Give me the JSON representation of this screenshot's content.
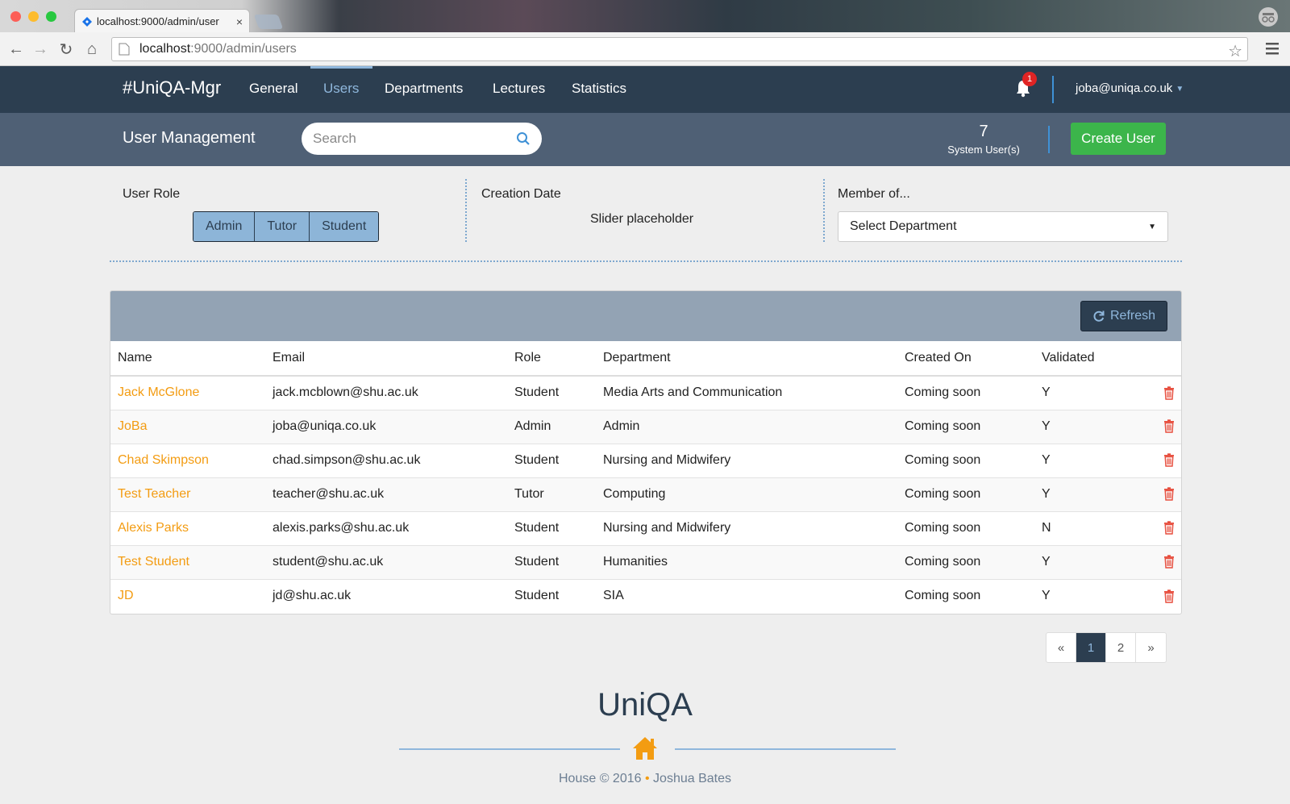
{
  "browser": {
    "tab_title": "localhost:9000/admin/user",
    "tab_close": "×",
    "url_host": "localhost",
    "url_rest": ":9000/admin/users"
  },
  "nav": {
    "brand": "#UniQA-Mgr",
    "items": [
      {
        "label": "General"
      },
      {
        "label": "Users"
      },
      {
        "label": "Departments"
      },
      {
        "label": "Lectures"
      },
      {
        "label": "Statistics"
      }
    ],
    "notification_count": "1",
    "user_email": "joba@uniqa.co.uk"
  },
  "subheader": {
    "title": "User Management",
    "search_placeholder": "Search",
    "user_count": "7",
    "user_count_label": "System User(s)",
    "create_button": "Create User"
  },
  "filters": {
    "role_label": "User Role",
    "roles": [
      "Admin",
      "Tutor",
      "Student"
    ],
    "date_label": "Creation Date",
    "slider_placeholder": "Slider placeholder",
    "member_label": "Member of...",
    "department_select": "Select Department"
  },
  "table": {
    "refresh_label": "Refresh",
    "columns": [
      "Name",
      "Email",
      "Role",
      "Department",
      "Created On",
      "Validated"
    ],
    "rows": [
      {
        "name": "Jack McGlone",
        "email": "jack.mcblown@shu.ac.uk",
        "role": "Student",
        "department": "Media Arts and Communication",
        "created": "Coming soon",
        "validated": "Y"
      },
      {
        "name": "JoBa",
        "email": "joba@uniqa.co.uk",
        "role": "Admin",
        "department": "Admin",
        "created": "Coming soon",
        "validated": "Y"
      },
      {
        "name": "Chad Skimpson",
        "email": "chad.simpson@shu.ac.uk",
        "role": "Student",
        "department": "Nursing and Midwifery",
        "created": "Coming soon",
        "validated": "Y"
      },
      {
        "name": "Test Teacher",
        "email": "teacher@shu.ac.uk",
        "role": "Tutor",
        "department": "Computing",
        "created": "Coming soon",
        "validated": "Y"
      },
      {
        "name": "Alexis Parks",
        "email": "alexis.parks@shu.ac.uk",
        "role": "Student",
        "department": "Nursing and Midwifery",
        "created": "Coming soon",
        "validated": "N"
      },
      {
        "name": "Test Student",
        "email": "student@shu.ac.uk",
        "role": "Student",
        "department": "Humanities",
        "created": "Coming soon",
        "validated": "Y"
      },
      {
        "name": "JD",
        "email": "jd@shu.ac.uk",
        "role": "Student",
        "department": "SIA",
        "created": "Coming soon",
        "validated": "Y"
      }
    ]
  },
  "pagination": {
    "prev": "«",
    "pages": [
      "1",
      "2"
    ],
    "next": "»"
  },
  "footer": {
    "title": "UniQA",
    "left": "House © 2016",
    "separator": "•",
    "right": "Joshua Bates"
  },
  "colors": {
    "navbar": "#2c3e50",
    "subheader": "#4f6075",
    "accent": "#8fb7dc",
    "create": "#3cb54b",
    "name_link": "#f39c12",
    "delete": "#e74c3c"
  },
  "icons": [
    "back-icon",
    "forward-icon",
    "reload-icon",
    "home-icon",
    "star-icon",
    "chrome-menu-icon",
    "bell-icon",
    "search-icon",
    "refresh-icon",
    "trash-icon",
    "house-icon"
  ]
}
